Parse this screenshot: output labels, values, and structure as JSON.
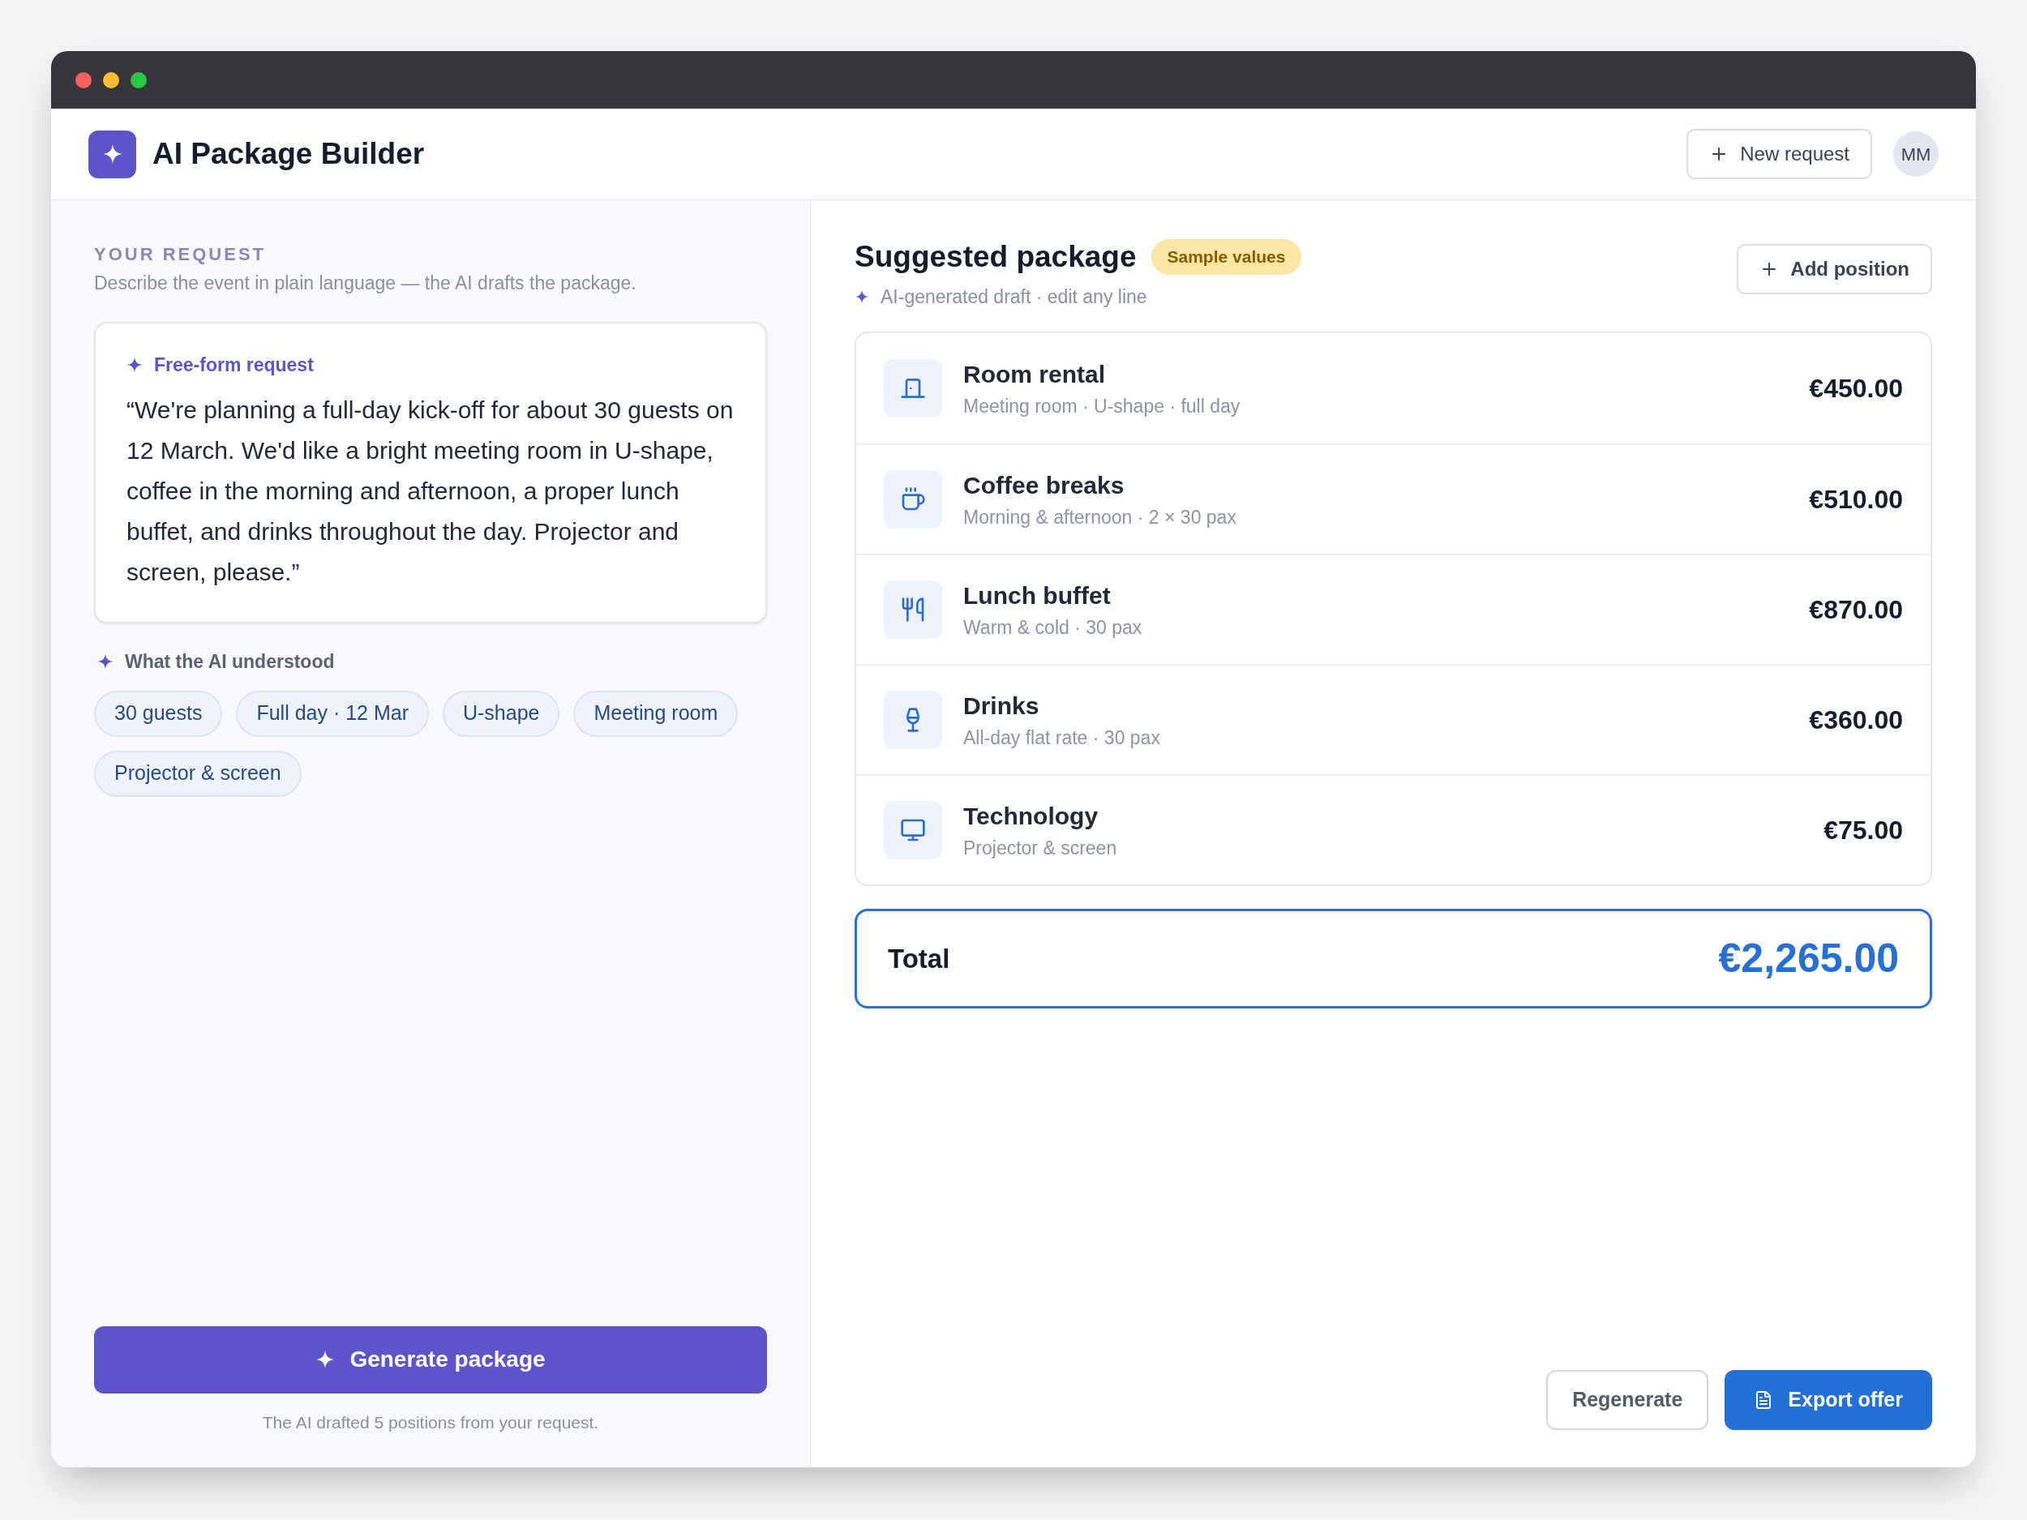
{
  "header": {
    "title": "AI Package Builder",
    "new_request_button": "New request",
    "avatar": "MM"
  },
  "request": {
    "section_label": "YOUR REQUEST",
    "section_hint": "Describe the event in plain language — the AI drafts the package.",
    "card_label": "Free-form request",
    "card_text": "“We're planning a full-day kick-off for about 30 guests on 12 March. We'd like a bright meeting room in U-shape, coffee in the morning and afternoon, a proper lunch buffet, and drinks throughout the day. Projector and screen, please.”",
    "understood_label": "What the AI understood",
    "chips": [
      "30 guests",
      "Full day · 12 Mar",
      "U-shape",
      "Meeting room",
      "Projector & screen"
    ],
    "generate_button": "Generate package",
    "footer_note": "The AI drafted 5 positions from your request."
  },
  "package": {
    "title": "Suggested package",
    "badge": "Sample values",
    "subtitle": "AI-generated draft · edit any line",
    "add_button": "Add position",
    "items": [
      {
        "kind": "room",
        "name": "Room rental",
        "detail": "Meeting room · U-shape · full day",
        "price": "€450.00"
      },
      {
        "kind": "coffee",
        "name": "Coffee breaks",
        "detail": "Morning & afternoon · 2 × 30 pax",
        "price": "€510.00"
      },
      {
        "kind": "food",
        "name": "Lunch buffet",
        "detail": "Warm & cold · 30 pax",
        "price": "€870.00"
      },
      {
        "kind": "drinks",
        "name": "Drinks",
        "detail": "All-day flat rate · 30 pax",
        "price": "€360.00"
      },
      {
        "kind": "tech",
        "name": "Technology",
        "detail": "Projector & screen",
        "price": "€75.00"
      }
    ],
    "total_label": "Total",
    "total_value": "€2,265.00",
    "regenerate_button": "Regenerate",
    "export_button": "Export offer"
  }
}
